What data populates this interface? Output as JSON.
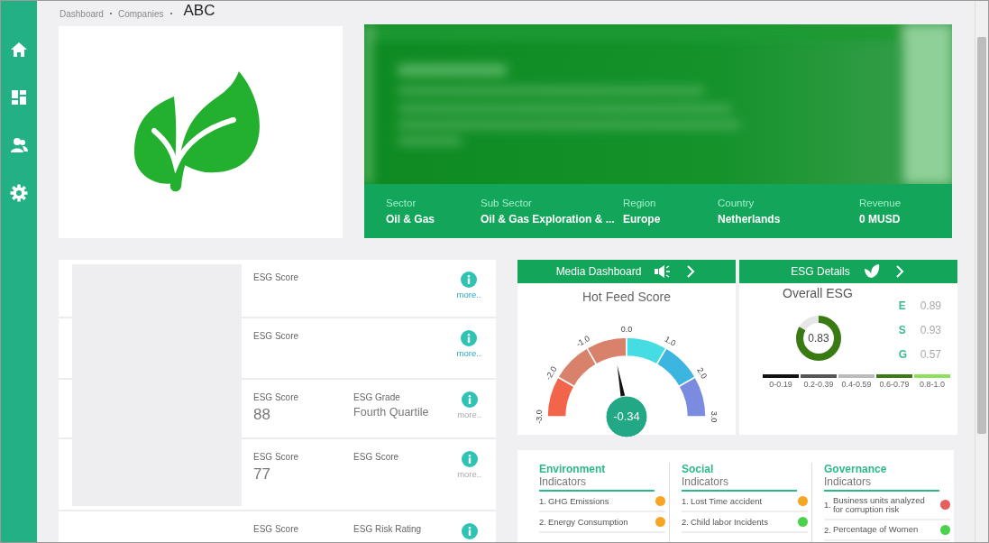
{
  "breadcrumb": {
    "items": [
      "Dashboard",
      "Companies"
    ],
    "current": "ABC"
  },
  "company": {
    "info": [
      {
        "label": "Sector",
        "value": "Oil & Gas"
      },
      {
        "label": "Sub Sector",
        "value": "Oil & Gas Exploration & ..."
      },
      {
        "label": "Region",
        "value": "Europe"
      },
      {
        "label": "Country",
        "value": "Netherlands"
      },
      {
        "label": "Revenue",
        "value": "0 MUSD"
      }
    ]
  },
  "scores": [
    {
      "fields": [
        {
          "label": "ESG Score"
        }
      ],
      "more": {
        "text": "more..",
        "disabled": false
      }
    },
    {
      "fields": [
        {
          "label": "ESG Score"
        }
      ],
      "more": {
        "text": "more..",
        "disabled": false
      }
    },
    {
      "fields": [
        {
          "label": "ESG Score",
          "value": "88"
        },
        {
          "label": "ESG Grade",
          "value": "Fourth Quartile"
        }
      ],
      "more": {
        "text": "more..",
        "disabled": true
      }
    },
    {
      "fields": [
        {
          "label": "ESG Score",
          "value": "77"
        },
        {
          "label": "ESG Score"
        }
      ],
      "more": {
        "text": "more..",
        "disabled": true
      }
    },
    {
      "fields": [
        {
          "label": "ESG Score"
        },
        {
          "label": "ESG Risk Rating"
        }
      ]
    }
  ],
  "media": {
    "title": "Media Dashboard",
    "gauge_title": "Hot Feed Score",
    "ticks": [
      "-3.0",
      "-2.0",
      "-1.0",
      "0.0",
      "1.0",
      "2.0",
      "3.0"
    ],
    "reading": "-0.34",
    "level": 0.443
  },
  "esg": {
    "title": "ESG Details",
    "subtitle": "Overall ESG",
    "score": "0.83",
    "level": 0.83,
    "pillars": [
      {
        "letter": "E",
        "value": "0.89"
      },
      {
        "letter": "S",
        "value": "0.93"
      },
      {
        "letter": "G",
        "value": "0.57"
      }
    ],
    "legend": [
      {
        "label": "0-0.19",
        "color": "#111111"
      },
      {
        "label": "0.2-0.39",
        "color": "#555555"
      },
      {
        "label": "0.4-0.59",
        "color": "#bbbbbb"
      },
      {
        "label": "0.6-0.79",
        "color": "#3a7a12"
      },
      {
        "label": "0.8-1.0",
        "color": "#8ee05a"
      }
    ]
  },
  "indicators": [
    {
      "title": "Environment",
      "subtitle": "Indicators",
      "items": [
        {
          "number": "1.",
          "text": "GHG Emissions",
          "color": "#f5a623"
        },
        {
          "number": "2.",
          "text": "Energy Consumption",
          "color": "#f5a623"
        }
      ]
    },
    {
      "title": "Social",
      "subtitle": "Indicators",
      "items": [
        {
          "number": "1.",
          "text": "Lost Time accident",
          "color": "#f5a623"
        },
        {
          "number": "2.",
          "text": "Child labor Incidents",
          "color": "#4cd14c"
        }
      ]
    },
    {
      "title": "Governance",
      "subtitle": "Indicators",
      "items": [
        {
          "number": "1.",
          "text": "Business units analyzed for corruption risk",
          "color": "#e85d5d"
        },
        {
          "number": "2.",
          "text": "Percentage of Women",
          "color": "#4cd14c"
        }
      ]
    }
  ]
}
